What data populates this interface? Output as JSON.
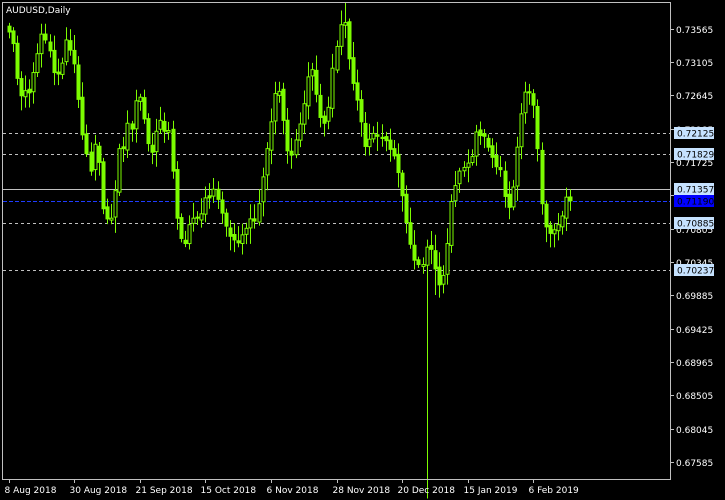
{
  "window": {
    "symbol_title": "AUDUSD,Daily"
  },
  "colors": {
    "background": "#000000",
    "frame": "#c0c0c0",
    "candle": "#7cfc00",
    "level_line": "#c0c0c0",
    "level_label_bg": "#c6e2ff",
    "level_label_text": "#000000",
    "current_price_bg": "#0000ff",
    "current_price_line": "#1e3cff",
    "current_price_text": "#000000",
    "axis_text": "#ffffff"
  },
  "chart_data": {
    "type": "candlestick",
    "symbol": "AUDUSD",
    "timeframe": "Daily",
    "ylim": [
      0.6735,
      0.7392
    ],
    "y_ticks": [
      "0.73565",
      "0.73105",
      "0.72645",
      "0.72185",
      "0.71725",
      "0.71265",
      "0.70805",
      "0.70345",
      "0.69885",
      "0.69425",
      "0.68965",
      "0.68505",
      "0.68045",
      "0.67585"
    ],
    "x_ticks": [
      {
        "label": "8 Aug 2018",
        "index": 0
      },
      {
        "label": "30 Aug 2018",
        "index": 16
      },
      {
        "label": "21 Sep 2018",
        "index": 32
      },
      {
        "label": "15 Oct 2018",
        "index": 48
      },
      {
        "label": "6 Nov 2018",
        "index": 64
      },
      {
        "label": "28 Nov 2018",
        "index": 80
      },
      {
        "label": "20 Dec 2018",
        "index": 96
      },
      {
        "label": "15 Jan 2019",
        "index": 112
      },
      {
        "label": "6 Feb 2019",
        "index": 128
      }
    ],
    "levels": [
      {
        "value": 0.72125,
        "label": "0.72125",
        "style": "dashed"
      },
      {
        "value": 0.71829,
        "label": "0.71829",
        "style": "dashed"
      },
      {
        "value": 0.71357,
        "label": "0.71357",
        "style": "solid"
      },
      {
        "value": 0.70885,
        "label": "0.70885",
        "style": "dashed"
      },
      {
        "value": 0.70237,
        "label": "0.70237",
        "style": "dashed"
      }
    ],
    "current_price": {
      "value": 0.7119,
      "label": "0.71190"
    },
    "close": [
      0.7352,
      0.7336,
      0.7288,
      0.7264,
      0.7271,
      0.7268,
      0.7296,
      0.7322,
      0.7349,
      0.7341,
      0.7326,
      0.7296,
      0.7294,
      0.7309,
      0.7341,
      0.7327,
      0.7308,
      0.7259,
      0.721,
      0.7184,
      0.716,
      0.7197,
      0.7172,
      0.7108,
      0.7094,
      0.7095,
      0.7133,
      0.7191,
      0.7191,
      0.7226,
      0.7218,
      0.7257,
      0.7262,
      0.7232,
      0.7198,
      0.7186,
      0.7215,
      0.723,
      0.7215,
      0.7216,
      0.716,
      0.7095,
      0.7067,
      0.706,
      0.7086,
      0.7095,
      0.7095,
      0.7101,
      0.7123,
      0.7123,
      0.7135,
      0.7121,
      0.7102,
      0.7084,
      0.707,
      0.7065,
      0.7061,
      0.7072,
      0.7081,
      0.7094,
      0.7091,
      0.7115,
      0.7152,
      0.7191,
      0.7228,
      0.7267,
      0.727,
      0.723,
      0.7188,
      0.7182,
      0.7203,
      0.7225,
      0.7253,
      0.729,
      0.73,
      0.7266,
      0.7234,
      0.7226,
      0.7248,
      0.7302,
      0.7332,
      0.7362,
      0.7365,
      0.7315,
      0.7281,
      0.7258,
      0.7228,
      0.7194,
      0.7204,
      0.7212,
      0.7208,
      0.7205,
      0.7202,
      0.719,
      0.7181,
      0.7158,
      0.7126,
      0.7089,
      0.7059,
      0.7037,
      0.7031,
      0.7031,
      0.7055,
      0.7052,
      0.7025,
      0.7003,
      0.7016,
      0.706,
      0.7118,
      0.714,
      0.716,
      0.7165,
      0.7171,
      0.718,
      0.7214,
      0.7209,
      0.7208,
      0.7193,
      0.7179,
      0.7166,
      0.7162,
      0.7125,
      0.711,
      0.7138,
      0.7193,
      0.7239,
      0.7269,
      0.7268,
      0.7251,
      0.7191,
      0.7115,
      0.7083,
      0.7074,
      0.7079,
      0.7086,
      0.7098,
      0.7124,
      0.7119
    ]
  }
}
